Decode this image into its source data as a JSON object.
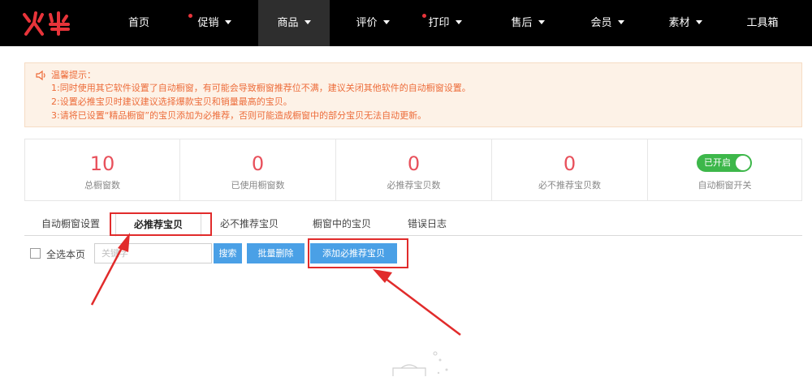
{
  "brand": {
    "logo_text": "火牛"
  },
  "nav": {
    "items": [
      {
        "label": "首页",
        "has_dot": false,
        "has_caret": false,
        "active": false
      },
      {
        "label": "促销",
        "has_dot": true,
        "has_caret": true,
        "active": false
      },
      {
        "label": "商品",
        "has_dot": false,
        "has_caret": true,
        "active": true
      },
      {
        "label": "评价",
        "has_dot": false,
        "has_caret": true,
        "active": false
      },
      {
        "label": "打印",
        "has_dot": true,
        "has_caret": true,
        "active": false
      },
      {
        "label": "售后",
        "has_dot": false,
        "has_caret": true,
        "active": false
      },
      {
        "label": "会员",
        "has_dot": false,
        "has_caret": true,
        "active": false
      },
      {
        "label": "素材",
        "has_dot": false,
        "has_caret": true,
        "active": false
      },
      {
        "label": "工具箱",
        "has_dot": false,
        "has_caret": false,
        "active": false
      }
    ]
  },
  "notice": {
    "title": "温馨提示：",
    "lines": [
      "1:同时使用其它软件设置了自动橱窗，有可能会导致橱窗推荐位不满，建议关闭其他软件的自动橱窗设置。",
      "2:设置必推宝贝时建议建议选择爆款宝贝和销量最高的宝贝。",
      "3:请将已设置“精品橱窗”的宝贝添加为必推荐，否则可能造成橱窗中的部分宝贝无法自动更新。"
    ]
  },
  "stats": [
    {
      "value": "10",
      "label": "总橱窗数"
    },
    {
      "value": "0",
      "label": "已使用橱窗数"
    },
    {
      "value": "0",
      "label": "必推荐宝贝数"
    },
    {
      "value": "0",
      "label": "必不推荐宝贝数"
    }
  ],
  "auto_switch": {
    "state_label": "已开启",
    "label": "自动橱窗开关",
    "on": true
  },
  "tabs": [
    {
      "label": "自动橱窗设置",
      "active": false
    },
    {
      "label": "必推荐宝贝",
      "active": true
    },
    {
      "label": "必不推荐宝贝",
      "active": false
    },
    {
      "label": "橱窗中的宝贝",
      "active": false
    },
    {
      "label": "错误日志",
      "active": false
    }
  ],
  "toolbar": {
    "select_all_label": "全选本页",
    "search_placeholder": "关键字",
    "search_button": "搜索",
    "batch_delete_button": "批量删除",
    "add_button": "添加必推荐宝贝"
  },
  "colors": {
    "accent_red": "#e8505b",
    "button_blue": "#4aa0e6",
    "toggle_green": "#3db74a",
    "notice_text": "#ed6c3a",
    "annotation_red": "#e12b2b"
  }
}
